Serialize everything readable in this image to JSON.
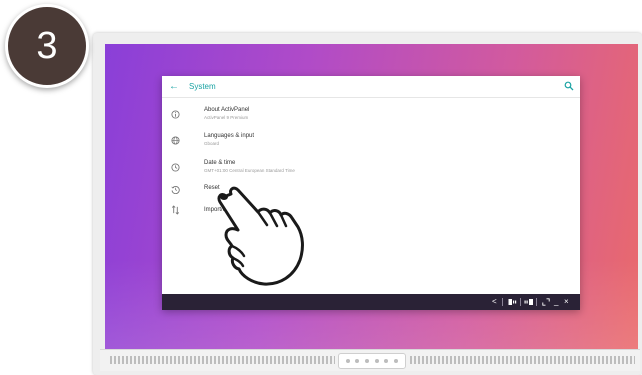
{
  "step": {
    "number": "3"
  },
  "window": {
    "title": "System",
    "back_icon": "arrow-left-icon",
    "search_icon": "search-icon"
  },
  "settings": {
    "items": [
      {
        "title": "About ActivPanel",
        "subtitle": "ActivPanel 9 Premium",
        "icon": "info-icon"
      },
      {
        "title": "Languages & input",
        "subtitle": "Gboard",
        "icon": "globe-icon"
      },
      {
        "title": "Date & time",
        "subtitle": "GMT+01:00 Central European Standard Time",
        "icon": "clock-icon"
      },
      {
        "title": "Reset",
        "subtitle": "",
        "icon": "history-icon"
      },
      {
        "title": "Import/export",
        "subtitle": "",
        "icon": "import-export-icon"
      }
    ]
  },
  "taskbar": {
    "back": "<",
    "minimize": "_",
    "close": "×"
  },
  "colors": {
    "accent": "#1aa3a3",
    "badge": "#4a3a36",
    "taskbar": "#2a2236"
  }
}
